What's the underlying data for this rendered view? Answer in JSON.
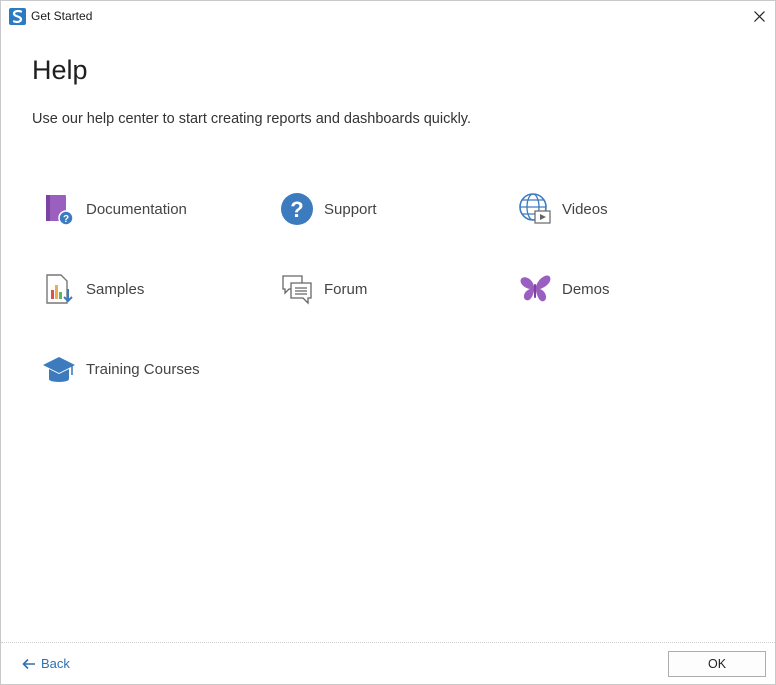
{
  "window": {
    "title": "Get Started",
    "close_icon": "close-icon"
  },
  "content": {
    "heading": "Help",
    "subtitle": "Use our help center to start creating reports and dashboards quickly."
  },
  "items": [
    {
      "label": "Documentation",
      "icon": "book-question-icon"
    },
    {
      "label": "Support",
      "icon": "question-circle-icon"
    },
    {
      "label": "Videos",
      "icon": "globe-video-icon"
    },
    {
      "label": "Samples",
      "icon": "chart-document-icon"
    },
    {
      "label": "Forum",
      "icon": "chat-bubbles-icon"
    },
    {
      "label": "Demos",
      "icon": "butterfly-icon"
    },
    {
      "label": "Training Courses",
      "icon": "graduation-cap-icon"
    }
  ],
  "footer": {
    "back_label": "Back",
    "ok_label": "OK"
  },
  "colors": {
    "accent_blue": "#3d7bbf",
    "purple": "#9b5fc0",
    "link_blue": "#2f6fb0"
  }
}
